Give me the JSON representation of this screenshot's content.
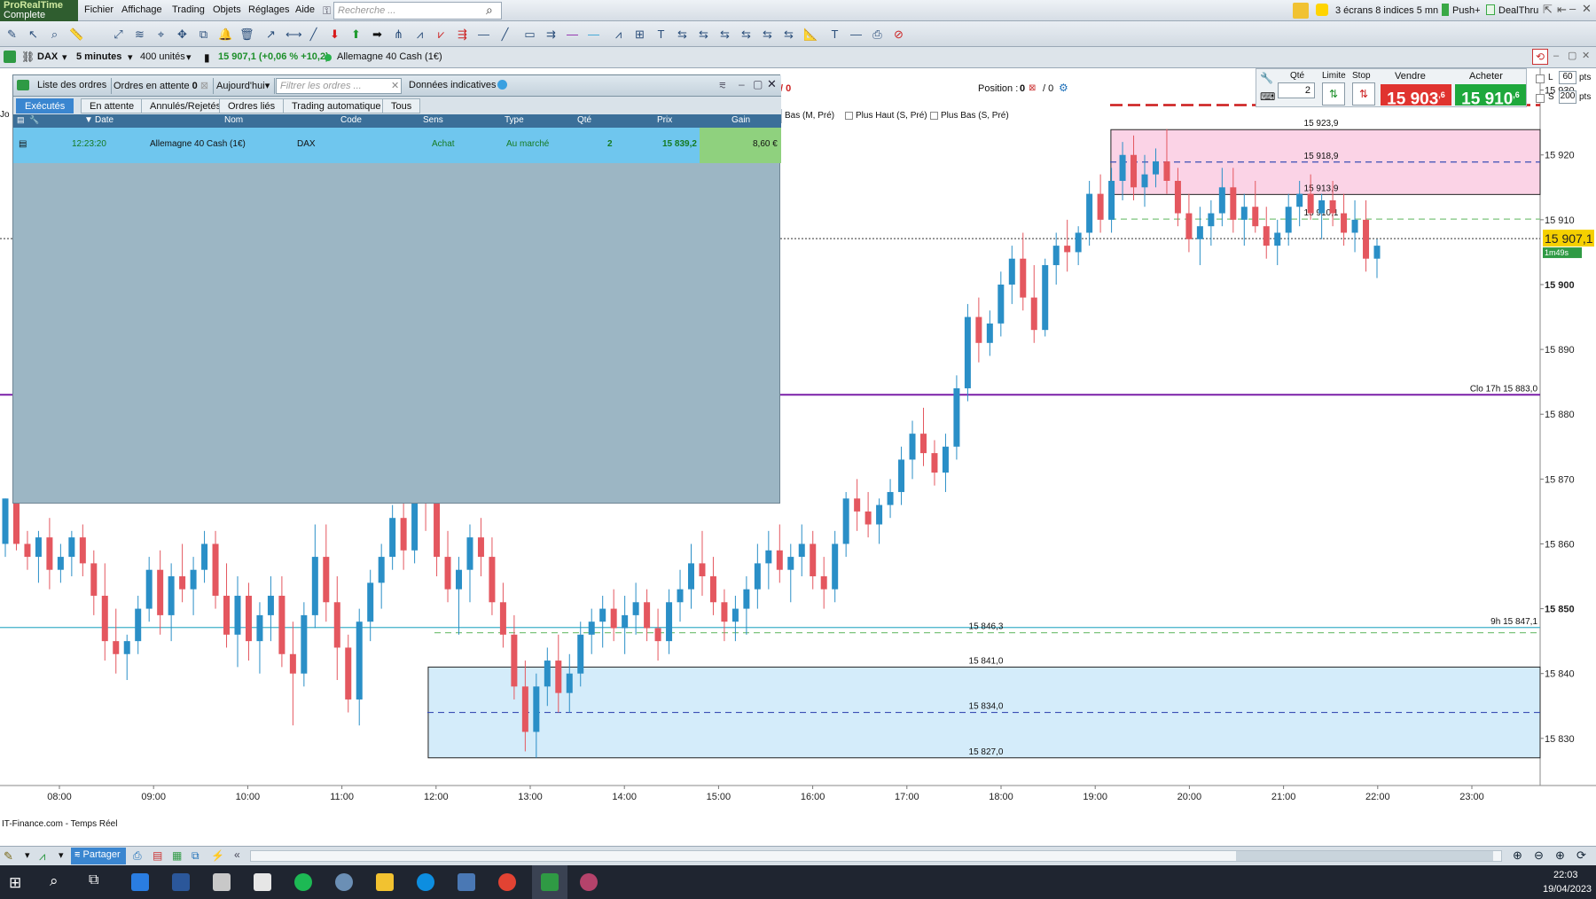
{
  "app": {
    "brand": "ProRealTime",
    "edition": "Complete"
  },
  "menu": [
    "Fichier",
    "Affichage",
    "Trading",
    "Objets",
    "Réglages",
    "Aide"
  ],
  "search": {
    "placeholder": "Recherche ..."
  },
  "topright": {
    "layout": "3 écrans 8 indices 5 mn",
    "push": "Push+",
    "broker": "DealThru"
  },
  "instrument": {
    "symbol": "DAX",
    "timeframe": "5 minutes",
    "units": "400 unités",
    "quote": "15 907,1 (+0,06 % +10,2)",
    "name": "Allemagne 40 Cash (1€)"
  },
  "orders_panel": {
    "list_label": "Liste des ordres",
    "pending_label": "Ordres en attente",
    "pending_count": "0",
    "period": "Aujourd'hui",
    "filter_placeholder": "Filtrer les ordres ...",
    "indicative": "Données indicatives",
    "tabs": [
      "Exécutés",
      "En attente",
      "Annulés/Rejetés",
      "Ordres liés",
      "Trading automatique",
      "Tous"
    ],
    "columns": [
      "Date",
      "Nom",
      "Code",
      "Sens",
      "Type",
      "Qté",
      "Prix",
      "Gain"
    ],
    "row": {
      "date": "12:23:20",
      "name": "Allemagne 40 Cash (1€)",
      "code": "DAX",
      "side": "Achat",
      "type": "Au marché",
      "qty": "2",
      "price": "15 839,2",
      "gain": "8,60 €"
    }
  },
  "position": {
    "label": "Position :",
    "value": "0",
    "pnl": "/ 0",
    "side_pnl": "0",
    "left_pnl": "/ 0"
  },
  "trade_panel": {
    "qty_label": "Qté",
    "qty": "2",
    "limit_label": "Limite",
    "stop_label": "Stop",
    "sell_label": "Vendre",
    "buy_label": "Acheter",
    "sell_price": "15 903",
    "sell_sup": ",6",
    "buy_price": "15 910",
    "buy_sup": ",6",
    "l_label": "L",
    "l_pts": "60",
    "s_label": "S",
    "s_pts": "200",
    "pts": "pts"
  },
  "indicator_tabs": [
    "Bas (M, Pré)",
    "Plus Haut (S, Pré)",
    "Plus Bas (S, Pré)"
  ],
  "footer_source": "IT-Finance.com - Temps Réel",
  "share_label": "Partager",
  "clock": {
    "time": "22:03",
    "date": "19/04/2023"
  },
  "chart_data": {
    "type": "candlestick",
    "ylim": [
      15823,
      15932
    ],
    "y_ticks": [
      15830,
      15840,
      15850,
      15860,
      15870,
      15880,
      15890,
      15900,
      15910,
      15920,
      15930
    ],
    "y_tick_labels": [
      "15 830",
      "15 840",
      "15 850",
      "15 860",
      "15 870",
      "15 880",
      "15 890",
      "15 900",
      "15 910",
      "15 920",
      "15 930"
    ],
    "x_ticks": [
      "08:00",
      "09:00",
      "10:00",
      "11:00",
      "12:00",
      "13:00",
      "14:00",
      "15:00",
      "16:00",
      "17:00",
      "18:00",
      "19:00",
      "20:00",
      "21:00",
      "22:00",
      "23:00"
    ],
    "current_price": "15 907,1",
    "countdown": "1m49s",
    "levels": [
      {
        "label": "15 927,7",
        "value": 15927.7,
        "color": "#cc1a1a",
        "style": "dashed"
      },
      {
        "label": "15 923,9",
        "value": 15923.9,
        "color": "#222222",
        "style": "solid"
      },
      {
        "label": "15 918,9",
        "value": 15918.9,
        "color": "#3a4fb5",
        "style": "dashed"
      },
      {
        "label": "15 913,9",
        "value": 15913.9,
        "color": "#222222",
        "style": "solid"
      },
      {
        "label": "15 910,1",
        "value": 15910.1,
        "color": "#7dc47d",
        "style": "dashed"
      },
      {
        "label": "Clo 17h 15 883,0",
        "value": 15883.0,
        "color": "#7a1fa8",
        "style": "solid"
      },
      {
        "label": "9h 15 847,1",
        "value": 15847.1,
        "color": "#3fb0c9",
        "style": "solid"
      },
      {
        "label": "15 846,3",
        "value": 15846.3,
        "color": "#7dc47d",
        "style": "dashed"
      },
      {
        "label": "15 841,0",
        "value": 15841.0,
        "color": "#222222",
        "style": "solid"
      },
      {
        "label": "15 834,0",
        "value": 15834.0,
        "color": "#3a4fb5",
        "style": "dashed"
      },
      {
        "label": "15 827,0",
        "value": 15827.0,
        "color": "#222222",
        "style": "solid"
      }
    ],
    "zones": [
      {
        "from": 15913.9,
        "to": 15923.9,
        "color": "#fbd3e6",
        "start_time": "19:10"
      },
      {
        "from": 15827.0,
        "to": 15841.0,
        "color": "#d4ecfa",
        "start_time": "11:55"
      }
    ],
    "candles": [
      [
        15860,
        15867,
        15858,
        15867
      ],
      [
        15867,
        15869,
        15859,
        15860
      ],
      [
        15860,
        15862,
        15856,
        15858
      ],
      [
        15858,
        15862,
        15854,
        15861
      ],
      [
        15861,
        15864,
        15853,
        15856
      ],
      [
        15856,
        15860,
        15854,
        15858
      ],
      [
        15858,
        15862,
        15855,
        15861
      ],
      [
        15861,
        15863,
        15855,
        15857
      ],
      [
        15857,
        15859,
        15849,
        15852
      ],
      [
        15852,
        15857,
        15842,
        15845
      ],
      [
        15845,
        15850,
        15840,
        15843
      ],
      [
        15843,
        15846,
        15839,
        15845
      ],
      [
        15845,
        15852,
        15843,
        15850
      ],
      [
        15850,
        15858,
        15848,
        15856
      ],
      [
        15856,
        15859,
        15846,
        15849
      ],
      [
        15849,
        15857,
        15845,
        15855
      ],
      [
        15855,
        15860,
        15851,
        15853
      ],
      [
        15853,
        15858,
        15849,
        15856
      ],
      [
        15856,
        15862,
        15854,
        15860
      ],
      [
        15860,
        15862,
        15850,
        15852
      ],
      [
        15852,
        15857,
        15844,
        15846
      ],
      [
        15846,
        15855,
        15841,
        15852
      ],
      [
        15852,
        15854,
        15842,
        15845
      ],
      [
        15845,
        15851,
        15840,
        15849
      ],
      [
        15849,
        15855,
        15845,
        15852
      ],
      [
        15852,
        15855,
        15841,
        15843
      ],
      [
        15843,
        15848,
        15832,
        15840
      ],
      [
        15840,
        15851,
        15838,
        15849
      ],
      [
        15849,
        15863,
        15847,
        15858
      ],
      [
        15858,
        15863,
        15848,
        15851
      ],
      [
        15851,
        15855,
        15839,
        15844
      ],
      [
        15844,
        15846,
        15834,
        15836
      ],
      [
        15836,
        15850,
        15832,
        15848
      ],
      [
        15848,
        15856,
        15845,
        15854
      ],
      [
        15854,
        15860,
        15850,
        15858
      ],
      [
        15858,
        15866,
        15856,
        15864
      ],
      [
        15864,
        15867,
        15856,
        15859
      ],
      [
        15859,
        15871,
        15857,
        15869
      ],
      [
        15869,
        15872,
        15862,
        15867
      ],
      [
        15867,
        15868,
        15855,
        15858
      ],
      [
        15858,
        15862,
        15851,
        15853
      ],
      [
        15853,
        15858,
        15846,
        15856
      ],
      [
        15856,
        15863,
        15851,
        15861
      ],
      [
        15861,
        15864,
        15855,
        15858
      ],
      [
        15858,
        15861,
        15849,
        15851
      ],
      [
        15851,
        15854,
        15844,
        15846
      ],
      [
        15846,
        15849,
        15836,
        15838
      ],
      [
        15838,
        15842,
        15828,
        15831
      ],
      [
        15831,
        15840,
        15827,
        15838
      ],
      [
        15838,
        15844,
        15835,
        15842
      ],
      [
        15842,
        15846,
        15834,
        15837
      ],
      [
        15837,
        15843,
        15834,
        15840
      ],
      [
        15840,
        15848,
        15838,
        15846
      ],
      [
        15846,
        15850,
        15843,
        15848
      ],
      [
        15848,
        15852,
        15844,
        15850
      ],
      [
        15850,
        15853,
        15845,
        15847
      ],
      [
        15847,
        15852,
        15843,
        15849
      ],
      [
        15849,
        15854,
        15846,
        15851
      ],
      [
        15851,
        15853,
        15845,
        15847
      ],
      [
        15847,
        15850,
        15842,
        15845
      ],
      [
        15845,
        15853,
        15843,
        15851
      ],
      [
        15851,
        15856,
        15848,
        15853
      ],
      [
        15853,
        15860,
        15850,
        15857
      ],
      [
        15857,
        15862,
        15852,
        15855
      ],
      [
        15855,
        15858,
        15849,
        15851
      ],
      [
        15851,
        15853,
        15845,
        15848
      ],
      [
        15848,
        15852,
        15845,
        15850
      ],
      [
        15850,
        15855,
        15846,
        15853
      ],
      [
        15853,
        15860,
        15850,
        15857
      ],
      [
        15857,
        15862,
        15853,
        15859
      ],
      [
        15859,
        15863,
        15854,
        15856
      ],
      [
        15856,
        15860,
        15851,
        15858
      ],
      [
        15858,
        15863,
        15855,
        15860
      ],
      [
        15860,
        15862,
        15853,
        15855
      ],
      [
        15855,
        15858,
        15850,
        15853
      ],
      [
        15853,
        15862,
        15851,
        15860
      ],
      [
        15860,
        15868,
        15858,
        15867
      ],
      [
        15867,
        15870,
        15862,
        15865
      ],
      [
        15865,
        15868,
        15861,
        15863
      ],
      [
        15863,
        15867,
        15860,
        15866
      ],
      [
        15866,
        15870,
        15864,
        15868
      ],
      [
        15868,
        15875,
        15866,
        15873
      ],
      [
        15873,
        15879,
        15870,
        15877
      ],
      [
        15877,
        15881,
        15872,
        15874
      ],
      [
        15874,
        15876,
        15869,
        15871
      ],
      [
        15871,
        15877,
        15868,
        15875
      ],
      [
        15875,
        15886,
        15873,
        15884
      ],
      [
        15884,
        15897,
        15882,
        15895
      ],
      [
        15895,
        15898,
        15888,
        15891
      ],
      [
        15891,
        15896,
        15889,
        15894
      ],
      [
        15894,
        15902,
        15892,
        15900
      ],
      [
        15900,
        15906,
        15897,
        15904
      ],
      [
        15904,
        15908,
        15896,
        15898
      ],
      [
        15898,
        15903,
        15891,
        15893
      ],
      [
        15893,
        15904,
        15892,
        15903
      ],
      [
        15903,
        15908,
        15900,
        15906
      ],
      [
        15906,
        15910,
        15902,
        15905
      ],
      [
        15905,
        15909,
        15903,
        15908
      ],
      [
        15908,
        15916,
        15906,
        15914
      ],
      [
        15914,
        15917,
        15908,
        15910
      ],
      [
        15910,
        15918,
        15908,
        15916
      ],
      [
        15916,
        15922,
        15913,
        15920
      ],
      [
        15920,
        15923,
        15913,
        15915
      ],
      [
        15915,
        15920,
        15912,
        15917
      ],
      [
        15917,
        15921,
        15915,
        15919
      ],
      [
        15919,
        15924,
        15914,
        15916
      ],
      [
        15916,
        15918,
        15909,
        15911
      ],
      [
        15911,
        15914,
        15905,
        15907
      ],
      [
        15907,
        15912,
        15903,
        15909
      ],
      [
        15909,
        15913,
        15906,
        15911
      ],
      [
        15911,
        15918,
        15909,
        15915
      ],
      [
        15915,
        15918,
        15908,
        15910
      ],
      [
        15910,
        15914,
        15906,
        15912
      ],
      [
        15912,
        15916,
        15908,
        15909
      ],
      [
        15909,
        15912,
        15904,
        15906
      ],
      [
        15906,
        15910,
        15903,
        15908
      ],
      [
        15908,
        15914,
        15906,
        15912
      ],
      [
        15912,
        15916,
        15909,
        15914
      ],
      [
        15914,
        15917,
        15910,
        15911
      ],
      [
        15911,
        15914,
        15907,
        15913
      ],
      [
        15913,
        15916,
        15909,
        15911
      ],
      [
        15911,
        15914,
        15906,
        15908
      ],
      [
        15908,
        15913,
        15905,
        15910
      ],
      [
        15910,
        15913,
        15902,
        15904
      ],
      [
        15904,
        15907,
        15901,
        15906
      ]
    ]
  }
}
